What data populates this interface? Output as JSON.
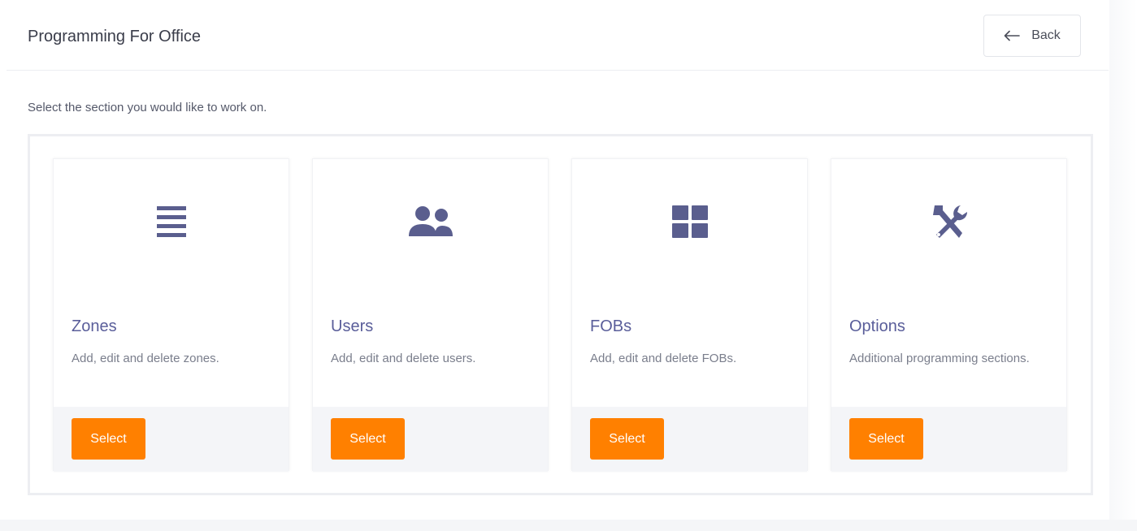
{
  "header": {
    "title": "Programming For Office",
    "back_label": "Back"
  },
  "instruction": "Select the section you would like to work on.",
  "accent_color": "#ff8000",
  "icon_color": "#5a5e8e",
  "cards": [
    {
      "icon": "list-icon",
      "title": "Zones",
      "description": "Add, edit and delete zones.",
      "button_label": "Select"
    },
    {
      "icon": "users-icon",
      "title": "Users",
      "description": "Add, edit and delete users.",
      "button_label": "Select"
    },
    {
      "icon": "grid-icon",
      "title": "FOBs",
      "description": "Add, edit and delete FOBs.",
      "button_label": "Select"
    },
    {
      "icon": "tools-icon",
      "title": "Options",
      "description": "Additional programming sections.",
      "button_label": "Select"
    }
  ]
}
